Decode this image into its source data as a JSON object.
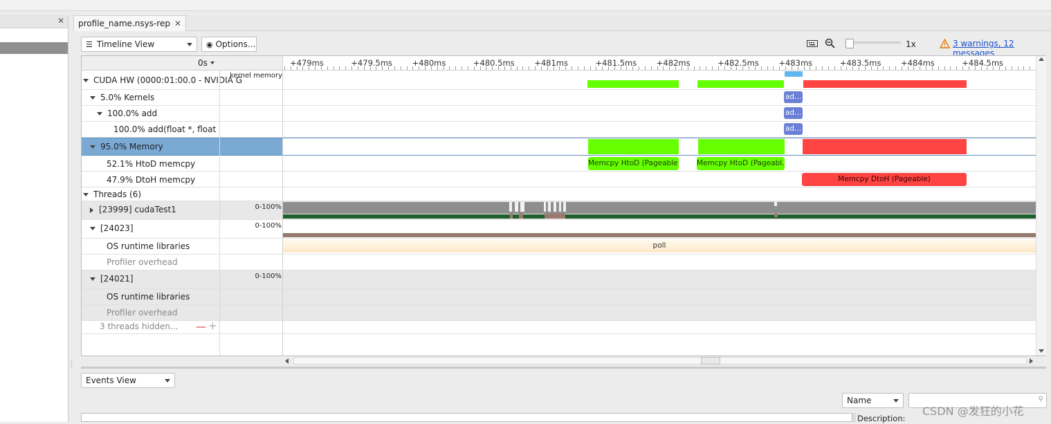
{
  "tab": {
    "title": "profile_name.nsys-rep",
    "close": "✕"
  },
  "toolbar": {
    "view_select": "Timeline View",
    "options_label": "Options...",
    "zoom_value": "1x",
    "warnings_link": "3 warnings, 12 messages"
  },
  "timeline": {
    "time_origin": "0s",
    "ruler_ticks": [
      "+479ms",
      "+479.5ms",
      "+480ms",
      "+480.5ms",
      "+481ms",
      "+481.5ms",
      "+482ms",
      "+482.5ms",
      "+483ms",
      "+483.5ms",
      "+484ms",
      "+484.5ms"
    ],
    "rows": [
      {
        "label": "CUDA HW (0000:01:00.0 - NVIDIA G",
        "col2": "kernel memory"
      },
      {
        "label": "5.0% Kernels"
      },
      {
        "label": "100.0% add"
      },
      {
        "label": "100.0% add(float *, float *, flo"
      },
      {
        "label": "95.0% Memory"
      },
      {
        "label": "52.1% HtoD memcpy"
      },
      {
        "label": "47.9% DtoH memcpy"
      },
      {
        "label": "Threads (6)"
      },
      {
        "label": "[23999] cudaTest1",
        "col2": "0-100%"
      },
      {
        "label": "[24023]",
        "col2": "0-100%"
      },
      {
        "label": "OS runtime libraries"
      },
      {
        "label": "Profiler overhead"
      },
      {
        "label": "[24021]",
        "col2": "0-100%"
      },
      {
        "label": "OS runtime libraries"
      },
      {
        "label": "Profiler overhead"
      },
      {
        "label": "3 threads hidden..."
      }
    ],
    "chips": {
      "kernel_short": "ad...",
      "htod_1": "Memcpy HtoD (Pageable)",
      "htod_2": "Memcpy HtoD (Pageabl...",
      "dtoh": "Memcpy DtoH (Pageable)",
      "poll": "poll"
    },
    "colors": {
      "htod": "#66ff00",
      "dtoh": "#ff4444",
      "kernel": "#6b7fd7",
      "selected_row": "#7aa9d4",
      "thread_bar": "#8e8e8e",
      "thread_green": "#1f5f2b",
      "poll_bar": "#fdf1de"
    }
  },
  "events": {
    "view_select": "Events View",
    "sort_select": "Name",
    "description_label": "Description:"
  },
  "watermark": "CSDN @发狂的小花"
}
